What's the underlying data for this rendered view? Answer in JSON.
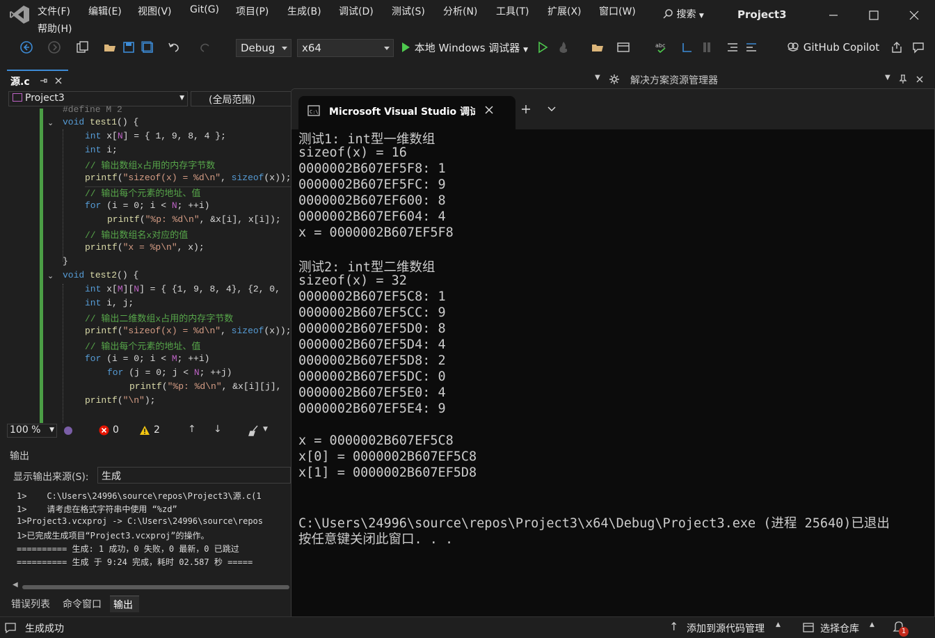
{
  "menu": {
    "items": [
      "文件(F)",
      "编辑(E)",
      "视图(V)",
      "Git(G)",
      "项目(P)",
      "生成(B)",
      "调试(D)",
      "测试(S)",
      "分析(N)",
      "工具(T)",
      "扩展(X)",
      "窗口(W)"
    ],
    "help": "帮助(H)",
    "search": "搜索",
    "project_title": "Project3"
  },
  "toolbar": {
    "config": "Debug",
    "platform": "x64",
    "run_label": "本地 Windows 调试器",
    "copilot": "GitHub Copilot"
  },
  "doc_tab": {
    "label": "源.c"
  },
  "editor": {
    "project_combo": "Project3",
    "scope_combo": "(全局范围)",
    "zoom": "100 %",
    "errors": "0",
    "warnings": "2"
  },
  "solution_explorer": {
    "title": "解决方案资源管理器"
  },
  "output": {
    "title": "输出",
    "source_label": "显示输出来源(S):",
    "source_value": "生成",
    "lines": [
      "1>    C:\\Users\\24996\\source\\repos\\Project3\\源.c(1",
      "1>    请考虑在格式字符串中使用 “%zd”",
      "1>Project3.vcxproj -> C:\\Users\\24996\\source\\repos",
      "1>已完成生成项目“Project3.vcxproj”的操作。",
      "========== 生成: 1 成功，0 失败，0 最新，0 已跳过",
      "========== 生成 于 9:24 完成，耗时 02.587 秒 ====="
    ]
  },
  "bottom_tabs": [
    "错误列表",
    "命令窗口",
    "输出"
  ],
  "status": {
    "message": "生成成功",
    "add_source": "添加到源代码管理",
    "select_repo": "选择仓库",
    "notifications": "1"
  },
  "console": {
    "tab_title": "Microsoft Visual Studio 调试控",
    "lines": [
      "测试1: int型一维数组",
      "sizeof(x) = 16",
      "0000002B607EF5F8: 1",
      "0000002B607EF5FC: 9",
      "0000002B607EF600: 8",
      "0000002B607EF604: 4",
      "x = 0000002B607EF5F8",
      "",
      "测试2: int型二维数组",
      "sizeof(x) = 32",
      "0000002B607EF5C8: 1",
      "0000002B607EF5CC: 9",
      "0000002B607EF5D0: 8",
      "0000002B607EF5D4: 4",
      "0000002B607EF5D8: 2",
      "0000002B607EF5DC: 0",
      "0000002B607EF5E0: 4",
      "0000002B607EF5E4: 9",
      "",
      "x = 0000002B607EF5C8",
      "x[0] = 0000002B607EF5C8",
      "x[1] = 0000002B607EF5D8",
      "",
      "",
      "C:\\Users\\24996\\source\\repos\\Project3\\x64\\Debug\\Project3.exe (进程 25640)已退出",
      "按任意键关闭此窗口. . ."
    ]
  }
}
